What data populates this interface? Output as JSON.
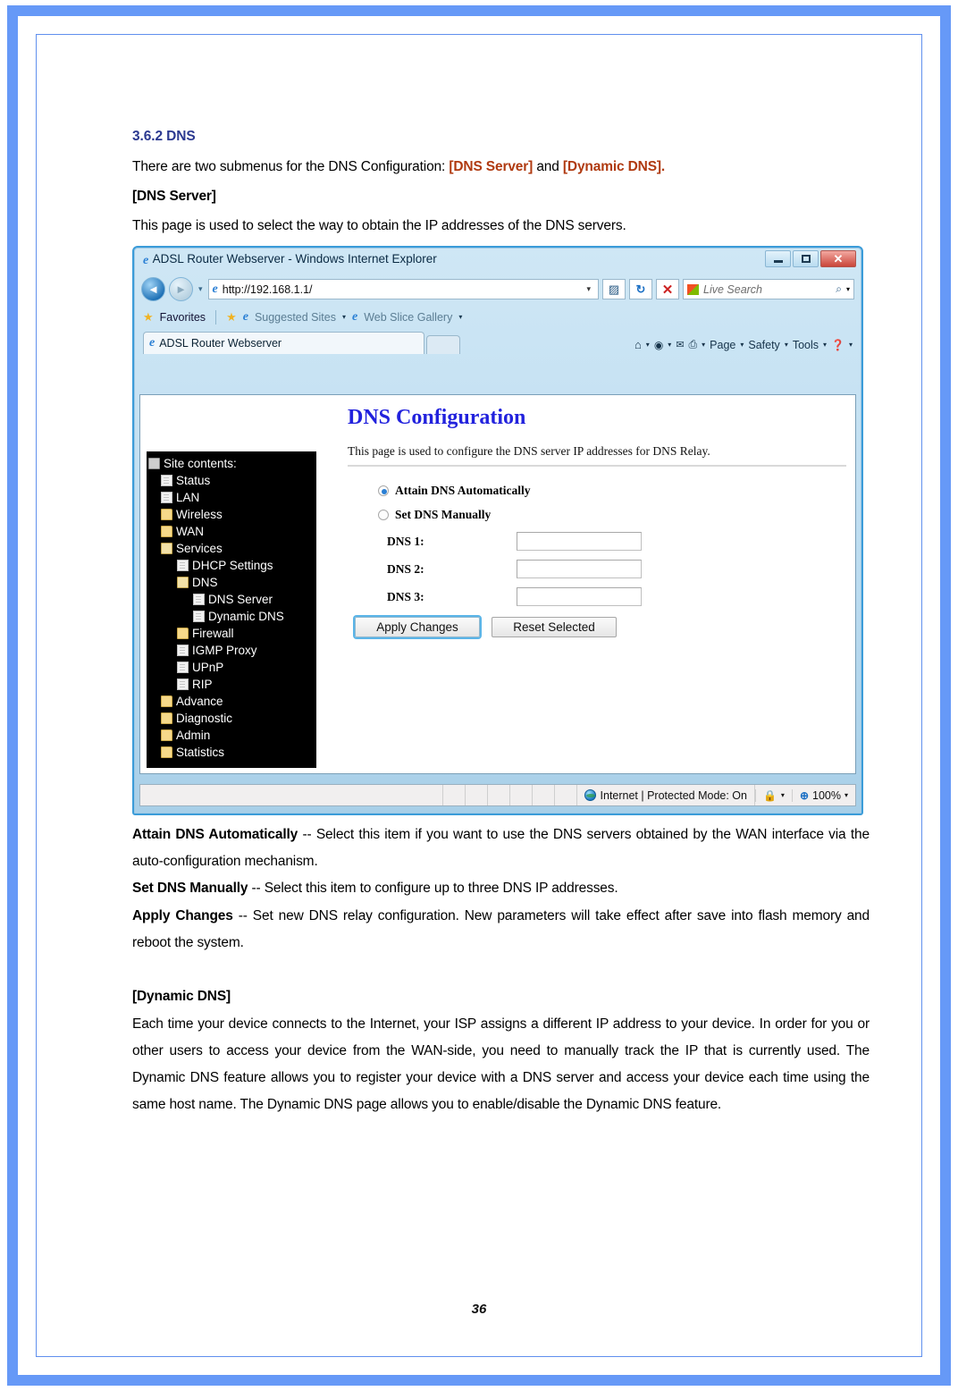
{
  "document": {
    "section_heading": "3.6.2 DNS",
    "intro_prefix": "There are two submenus for the DNS Configuration: ",
    "intro_link1": "[DNS Server]",
    "intro_mid": " and ",
    "intro_link2": "[Dynamic DNS].",
    "dns_server_heading": "[DNS Server]",
    "dns_server_desc": "This page is used to select the way to obtain the IP addresses of the DNS servers.",
    "bullets": [
      {
        "term": "Attain DNS Automatically",
        "text": " -- Select this item if you want to use the DNS servers obtained by the WAN interface via the auto-configuration mechanism."
      },
      {
        "term": "Set DNS Manually",
        "text": " -- Select this item to configure up to three DNS IP addresses."
      },
      {
        "term": "Apply Changes",
        "text": " -- Set new DNS relay configuration. New parameters will take effect after save into flash memory and reboot the system."
      }
    ],
    "dynamic_dns_heading": "[Dynamic DNS]",
    "dynamic_dns_para": "Each time your device connects to the Internet, your ISP assigns a different IP address to your device. In order for you or other users to access your device from the WAN-side, you need to manually track the IP that is currently used. The Dynamic DNS feature allows you to register your device with a DNS server and access your device each time using the same host name. The Dynamic DNS page allows you to enable/disable the Dynamic DNS feature.",
    "page_number": "36",
    "accent_color": "#b03a10",
    "heading_color": "#2b3990",
    "frame_color": "#6699f7"
  },
  "browser": {
    "title": "ADSL Router Webserver - Windows Internet Explorer",
    "window_controls": {
      "minimize": "minimize-button",
      "maximize": "maximize-button",
      "close": "close-button"
    },
    "address": {
      "url": "http://192.168.1.1/",
      "dropdown": "▾",
      "compat_icon": "compatibility-view-icon",
      "refresh_icon": "↻",
      "stop_icon": "✕"
    },
    "search": {
      "placeholder": "Live Search",
      "magnifier": "search-icon",
      "dropdown": "▾"
    },
    "favorites_bar": {
      "favorites_label": "Favorites",
      "suggested_sites": "Suggested Sites",
      "web_slice_gallery": "Web Slice Gallery"
    },
    "tab": {
      "label": "ADSL Router Webserver"
    },
    "command_bar": [
      {
        "name": "home-icon",
        "label": ""
      },
      {
        "name": "feeds-icon",
        "label": ""
      },
      {
        "name": "mail-icon",
        "label": ""
      },
      {
        "name": "print-icon",
        "label": ""
      },
      {
        "name": "page-menu",
        "label": "Page"
      },
      {
        "name": "safety-menu",
        "label": "Safety"
      },
      {
        "name": "tools-menu",
        "label": "Tools"
      },
      {
        "name": "help-menu",
        "label": ""
      }
    ],
    "status_bar": {
      "zone": "Internet | Protected Mode: On",
      "zoom": "100%"
    }
  },
  "router": {
    "sidebar": {
      "root": "Site contents:",
      "items": [
        {
          "label": "Status",
          "icon": "page-icon",
          "level": 1
        },
        {
          "label": "LAN",
          "icon": "page-icon",
          "level": 1
        },
        {
          "label": "Wireless",
          "icon": "folder-icon",
          "level": 1
        },
        {
          "label": "WAN",
          "icon": "folder-icon",
          "level": 1
        },
        {
          "label": "Services",
          "icon": "folder-open-icon",
          "level": 1
        },
        {
          "label": "DHCP Settings",
          "icon": "page-icon",
          "level": 2
        },
        {
          "label": "DNS",
          "icon": "folder-open-icon",
          "level": 2
        },
        {
          "label": "DNS Server",
          "icon": "page-icon",
          "level": 3
        },
        {
          "label": "Dynamic DNS",
          "icon": "page-icon",
          "level": 3
        },
        {
          "label": "Firewall",
          "icon": "folder-icon",
          "level": 2
        },
        {
          "label": "IGMP Proxy",
          "icon": "page-icon",
          "level": 2
        },
        {
          "label": "UPnP",
          "icon": "page-icon",
          "level": 2
        },
        {
          "label": "RIP",
          "icon": "page-icon",
          "level": 2
        },
        {
          "label": "Advance",
          "icon": "folder-icon",
          "level": 1
        },
        {
          "label": "Diagnostic",
          "icon": "folder-icon",
          "level": 1
        },
        {
          "label": "Admin",
          "icon": "folder-icon",
          "level": 1
        },
        {
          "label": "Statistics",
          "icon": "folder-icon",
          "level": 1
        }
      ]
    },
    "panel": {
      "title": "DNS Configuration",
      "description": "This page is used to configure the DNS server IP addresses for DNS Relay.",
      "radio_auto": {
        "label": "Attain DNS Automatically",
        "selected": true
      },
      "radio_manual": {
        "label": "Set DNS Manually",
        "selected": false
      },
      "fields": [
        {
          "label": "DNS 1:",
          "value": ""
        },
        {
          "label": "DNS 2:",
          "value": ""
        },
        {
          "label": "DNS 3:",
          "value": ""
        }
      ],
      "apply_button": "Apply Changes",
      "reset_button": "Reset Selected"
    }
  }
}
